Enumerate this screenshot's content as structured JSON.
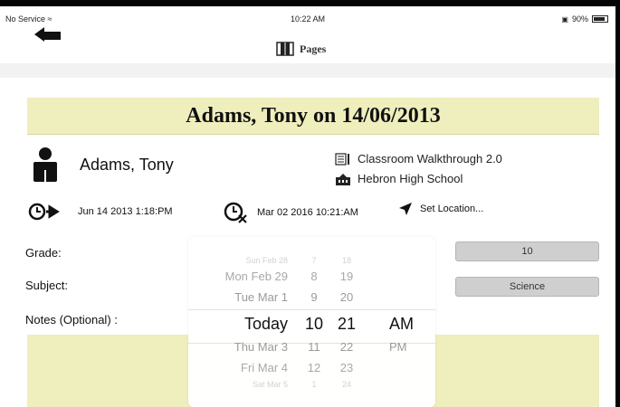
{
  "status": {
    "carrier": "No Service",
    "time": "10:22 AM",
    "battery": "90%"
  },
  "nav": {
    "title": "Pages"
  },
  "banner": {
    "title": "Adams, Tony on 14/06/2013"
  },
  "person": {
    "name": "Adams, Tony"
  },
  "form": {
    "name": "Classroom Walkthrough 2.0",
    "school": "Hebron High School"
  },
  "times": {
    "start": "Jun 14 2013 1:18:PM",
    "end": "Mar 02 2016 10:21:AM",
    "location": "Set Location..."
  },
  "fields": {
    "grade_label": "Grade:",
    "grade_value": "10",
    "subject_label": "Subject:",
    "subject_value": "Science",
    "notes_label": "Notes (Optional) :"
  },
  "picker": {
    "dates": [
      "Sun Feb 28",
      "Mon Feb 29",
      "Tue Mar 1",
      "Today",
      "Thu Mar 3",
      "Fri Mar 4",
      "Sat Mar 5"
    ],
    "hours": [
      "7",
      "8",
      "9",
      "10",
      "11",
      "12",
      "1"
    ],
    "minutes": [
      "18",
      "19",
      "20",
      "21",
      "22",
      "23",
      "24"
    ],
    "ampm": [
      "AM",
      "PM"
    ]
  },
  "colors": {
    "banner": "#efeebd",
    "select_button": "#cfcfcf"
  },
  "icons": [
    "back-arrow-icon",
    "book-icon",
    "person-icon",
    "form-icon",
    "school-icon",
    "start-clock-icon",
    "end-clock-icon",
    "location-arrow-icon"
  ]
}
